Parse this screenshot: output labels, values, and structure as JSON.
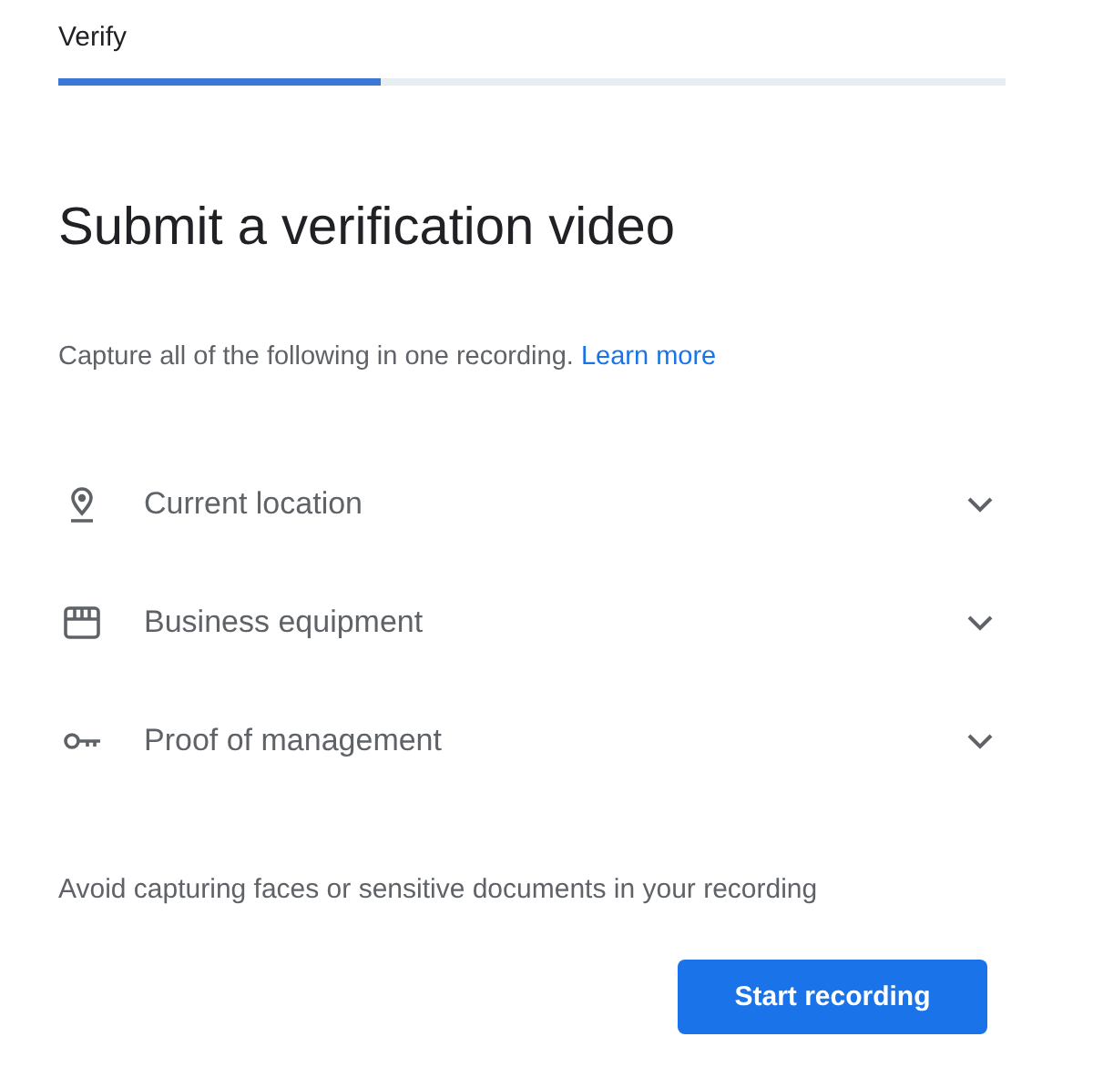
{
  "header": {
    "title": "Verify",
    "progress": {
      "level": 0.34
    }
  },
  "heading": "Submit a verification video",
  "intro": {
    "text": "Capture all of the following in one recording.",
    "link": "Learn more"
  },
  "items": [
    {
      "kind": "location",
      "label": "Current location",
      "expanded": false
    },
    {
      "kind": "storefront",
      "label": "Business equipment",
      "expanded": false
    },
    {
      "kind": "key",
      "label": "Proof of management",
      "expanded": false
    }
  ],
  "note": "Avoid capturing faces or sensitive documents in your recording",
  "button": "Start recording"
}
